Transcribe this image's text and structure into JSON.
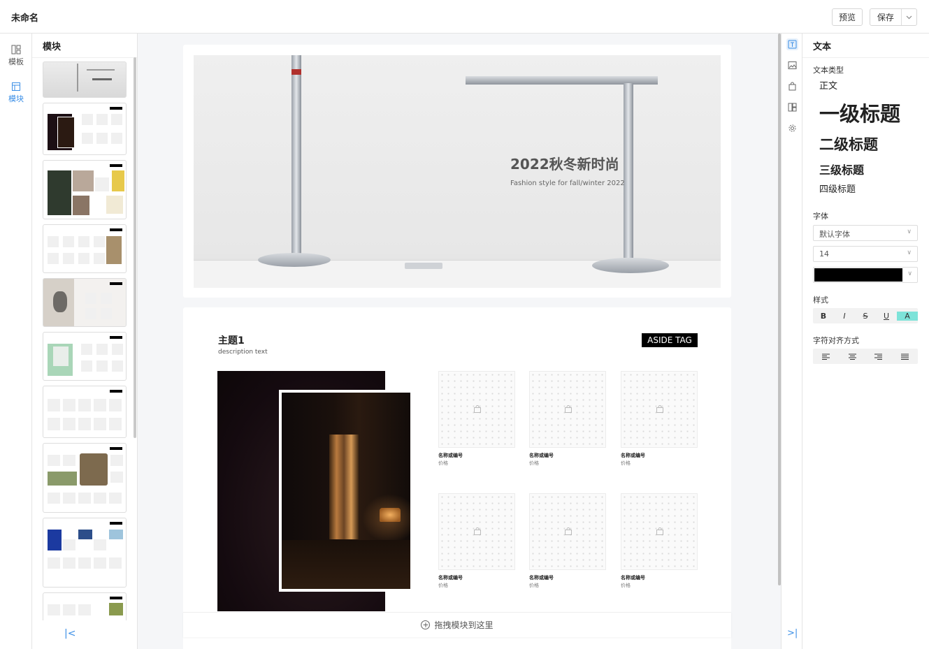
{
  "header": {
    "title": "未命名",
    "preview_label": "预览",
    "save_label": "保存"
  },
  "leftnav": {
    "items": [
      {
        "label": "模板",
        "icon": "template-icon",
        "active": false
      },
      {
        "label": "模块",
        "icon": "module-icon",
        "active": true
      }
    ]
  },
  "modules": {
    "title": "模块"
  },
  "hero": {
    "title": "2022秋冬新时尚",
    "subtitle": "Fashion style for fall/winter 2022"
  },
  "section": {
    "title": "主题1",
    "description": "description text",
    "aside_tag": "ASIDE TAG",
    "products": [
      {
        "name": "名称或编号",
        "price": "价格"
      },
      {
        "name": "名称或编号",
        "price": "价格"
      },
      {
        "name": "名称或编号",
        "price": "价格"
      },
      {
        "name": "名称或编号",
        "price": "价格"
      },
      {
        "name": "名称或编号",
        "price": "价格"
      },
      {
        "name": "名称或编号",
        "price": "价格"
      }
    ]
  },
  "dropzone": {
    "label": "拖拽模块到这里"
  },
  "props": {
    "title": "文本",
    "text_type_label": "文本类型",
    "text_types": [
      "正文",
      "一级标题",
      "二级标题",
      "三级标题",
      "四级标题"
    ],
    "font_label": "字体",
    "font_value": "默认字体",
    "size_value": "14",
    "color_value": "#000000",
    "style_label": "样式",
    "style_buttons": [
      "B",
      "I",
      "S",
      "U",
      "A"
    ],
    "align_label": "字符对齐方式"
  }
}
